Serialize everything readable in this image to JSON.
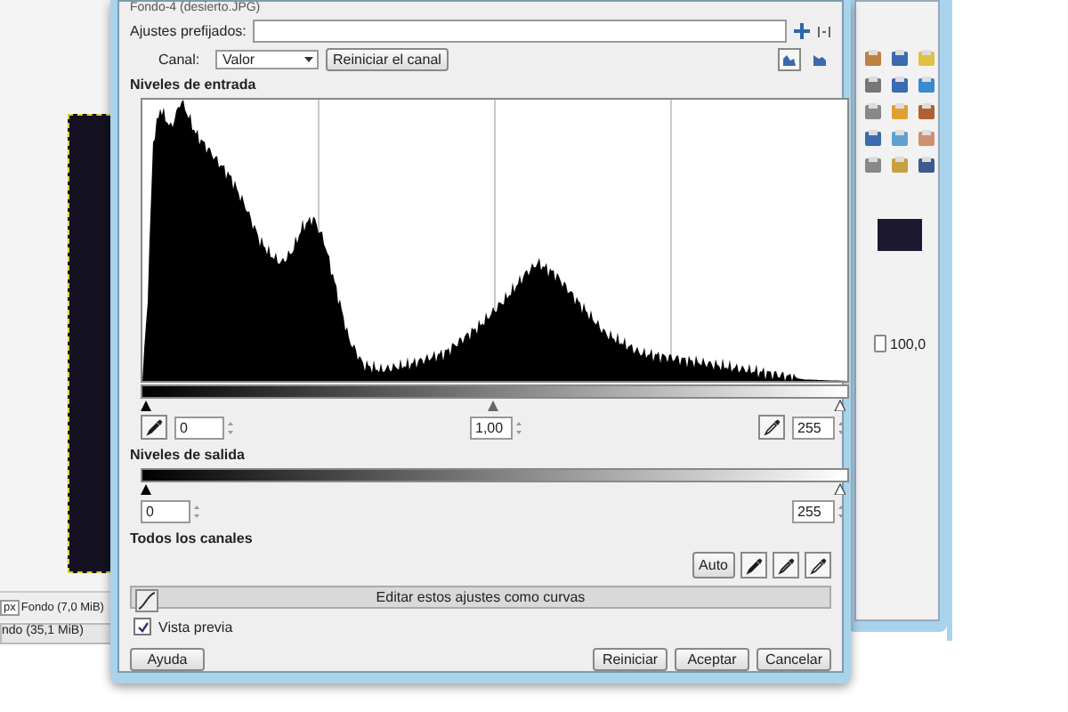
{
  "image_window": {
    "unit": "px",
    "layer_info": "Fondo (7,0 MiB)",
    "status_2": "ndo (35,1 MiB)"
  },
  "dialog": {
    "subtitle": "Fondo-4 (desierto.JPG)",
    "presets": {
      "label": "Ajustes prefijados:"
    },
    "channel": {
      "label": "Canal:",
      "value": "Valor",
      "reset": "Reiniciar el canal"
    },
    "input": {
      "heading": "Niveles de entrada",
      "low": "0",
      "gamma": "1,00",
      "high": "255"
    },
    "output": {
      "heading": "Niveles de salida",
      "low": "0",
      "high": "255"
    },
    "all_channels": {
      "heading": "Todos los canales",
      "auto": "Auto"
    },
    "curves_expander": "Editar estos ajustes como curvas",
    "preview": {
      "label": "Vista previa",
      "checked": true
    },
    "buttons": [
      {
        "label": "Ayuda",
        "kind": "left"
      },
      {
        "label": "Reiniciar",
        "kind": "right"
      },
      {
        "label": "Aceptar",
        "kind": "right"
      },
      {
        "label": "Cancelar",
        "kind": "right"
      }
    ]
  },
  "layers_panel": {
    "opacity": "100,0"
  }
}
